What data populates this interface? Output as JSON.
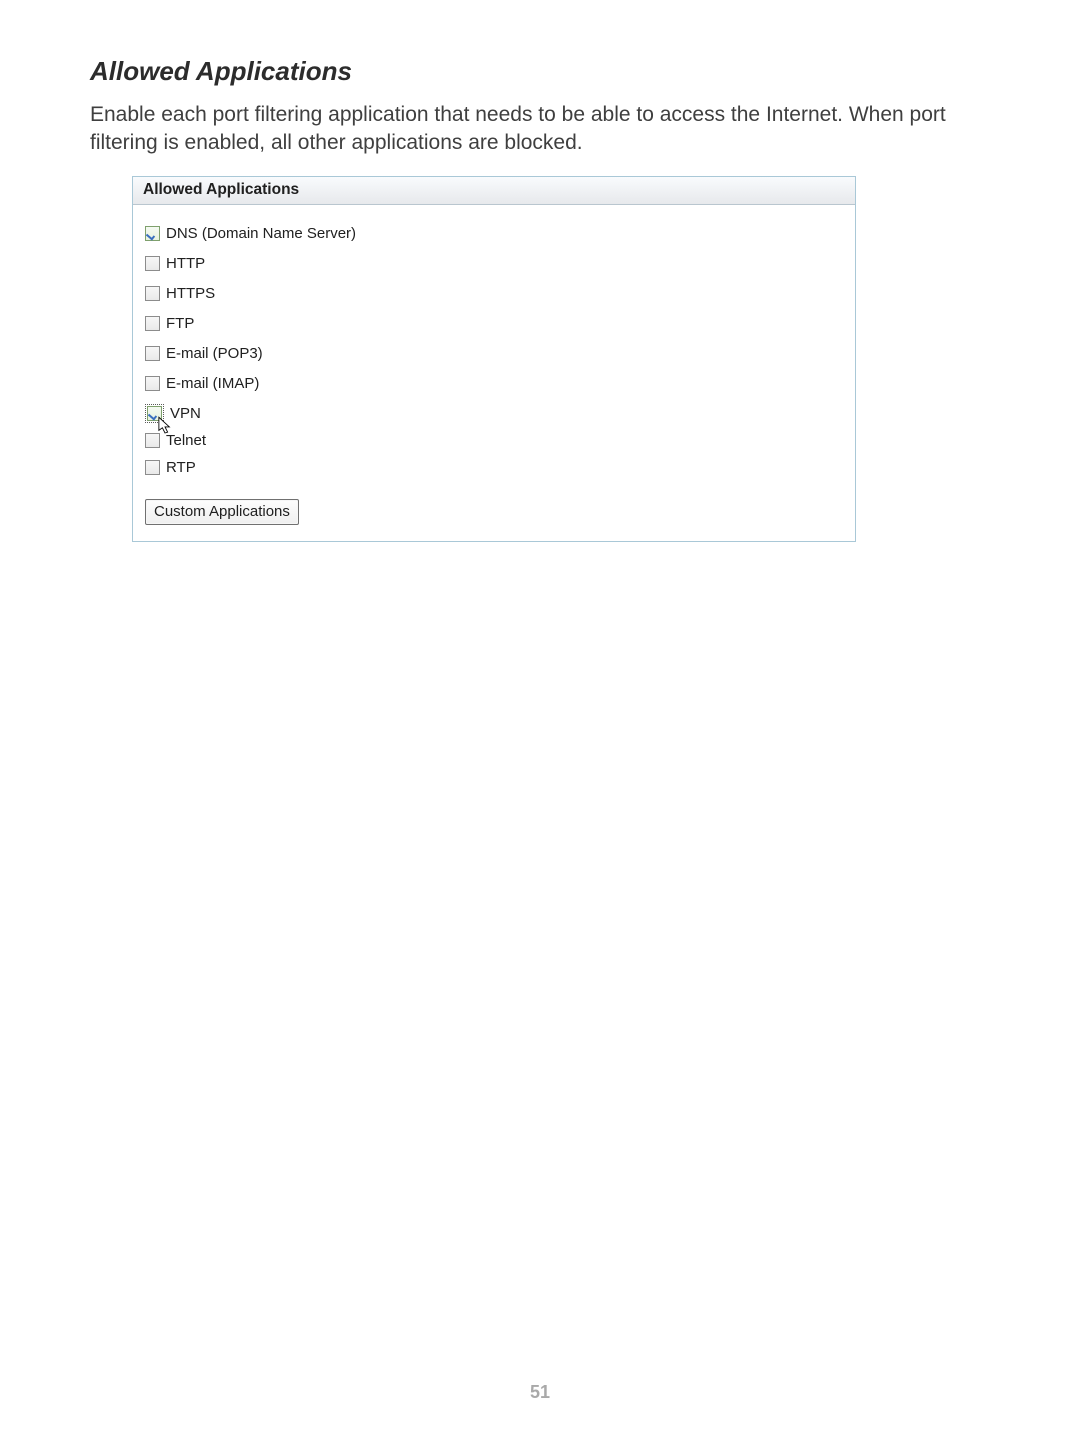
{
  "section_title": "Allowed Applications",
  "intro_text": "Enable each port filtering application that needs to be able to access the Internet. When port filtering is enabled, all other applications are blocked.",
  "panel": {
    "header": "Allowed Applications",
    "items": [
      {
        "label": "DNS (Domain Name Server)",
        "checked": true,
        "focused": false
      },
      {
        "label": "HTTP",
        "checked": false,
        "focused": false
      },
      {
        "label": "HTTPS",
        "checked": false,
        "focused": false
      },
      {
        "label": "FTP",
        "checked": false,
        "focused": false
      },
      {
        "label": "E-mail (POP3)",
        "checked": false,
        "focused": false
      },
      {
        "label": "E-mail (IMAP)",
        "checked": false,
        "focused": false
      },
      {
        "label": "VPN",
        "checked": true,
        "focused": true
      },
      {
        "label": "Telnet",
        "checked": false,
        "focused": false
      },
      {
        "label": "RTP",
        "checked": false,
        "focused": false
      }
    ],
    "button_label": "Custom Applications"
  },
  "page_number": "51"
}
